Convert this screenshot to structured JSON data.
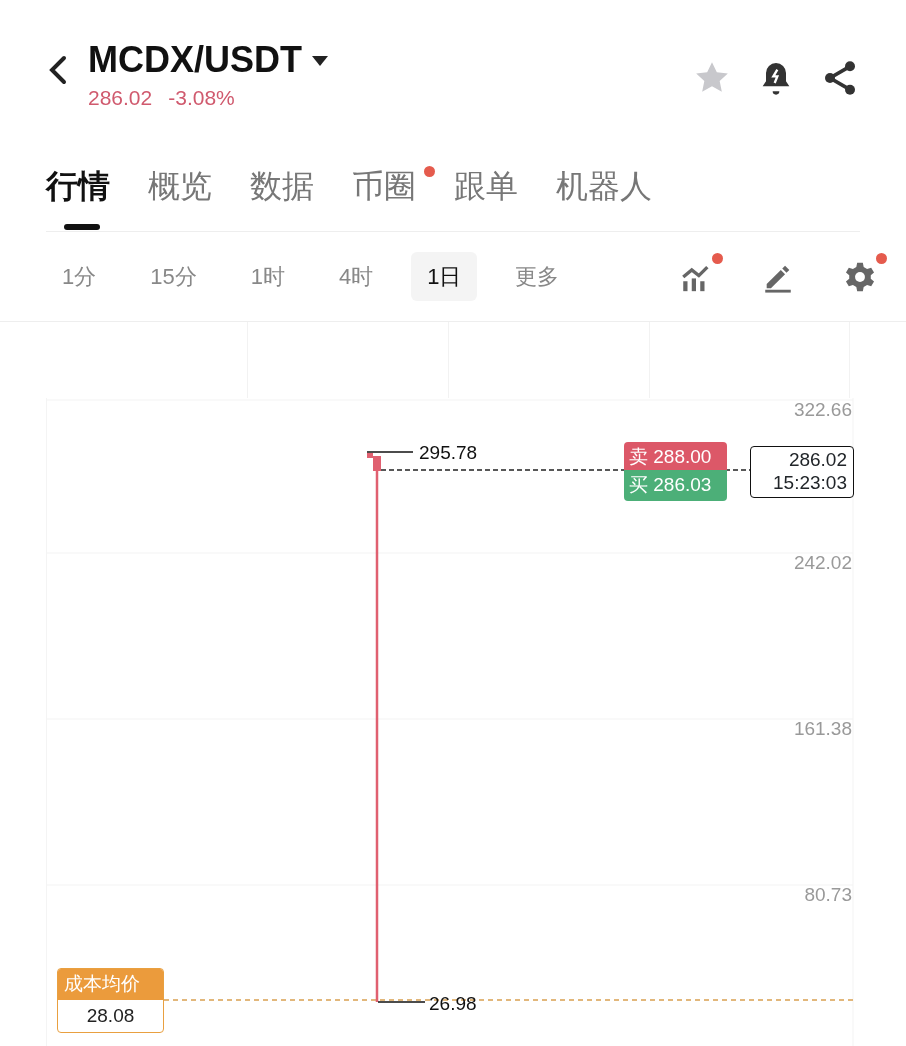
{
  "header": {
    "pair": "MCDX/USDT",
    "price": "286.02",
    "change": "-3.08%",
    "favorite": false
  },
  "tabs": [
    {
      "label": "行情",
      "selected": true,
      "dot": false
    },
    {
      "label": "概览",
      "selected": false,
      "dot": false
    },
    {
      "label": "数据",
      "selected": false,
      "dot": false
    },
    {
      "label": "币圈",
      "selected": false,
      "dot": true
    },
    {
      "label": "跟单",
      "selected": false,
      "dot": false
    },
    {
      "label": "机器人",
      "selected": false,
      "dot": false
    }
  ],
  "intervals": [
    {
      "label": "1分",
      "selected": false
    },
    {
      "label": "15分",
      "selected": false
    },
    {
      "label": "1时",
      "selected": false
    },
    {
      "label": "4时",
      "selected": false
    },
    {
      "label": "1日",
      "selected": true
    },
    {
      "label": "更多",
      "selected": false
    }
  ],
  "tools": [
    {
      "kind": "indicator",
      "dot": true
    },
    {
      "kind": "draw",
      "dot": false
    },
    {
      "kind": "settings",
      "dot": true
    }
  ],
  "chart": {
    "y_labels": [
      "322.66",
      "242.02",
      "161.38",
      "80.73"
    ],
    "high_label": "295.78",
    "low_label": "26.98",
    "ask": {
      "side": "卖",
      "price": "288.00"
    },
    "bid": {
      "side": "买",
      "price": "286.03"
    },
    "last_price": "286.02",
    "countdown": "15:23:03",
    "cost": {
      "label": "成本均价",
      "price": "28.08"
    }
  }
}
